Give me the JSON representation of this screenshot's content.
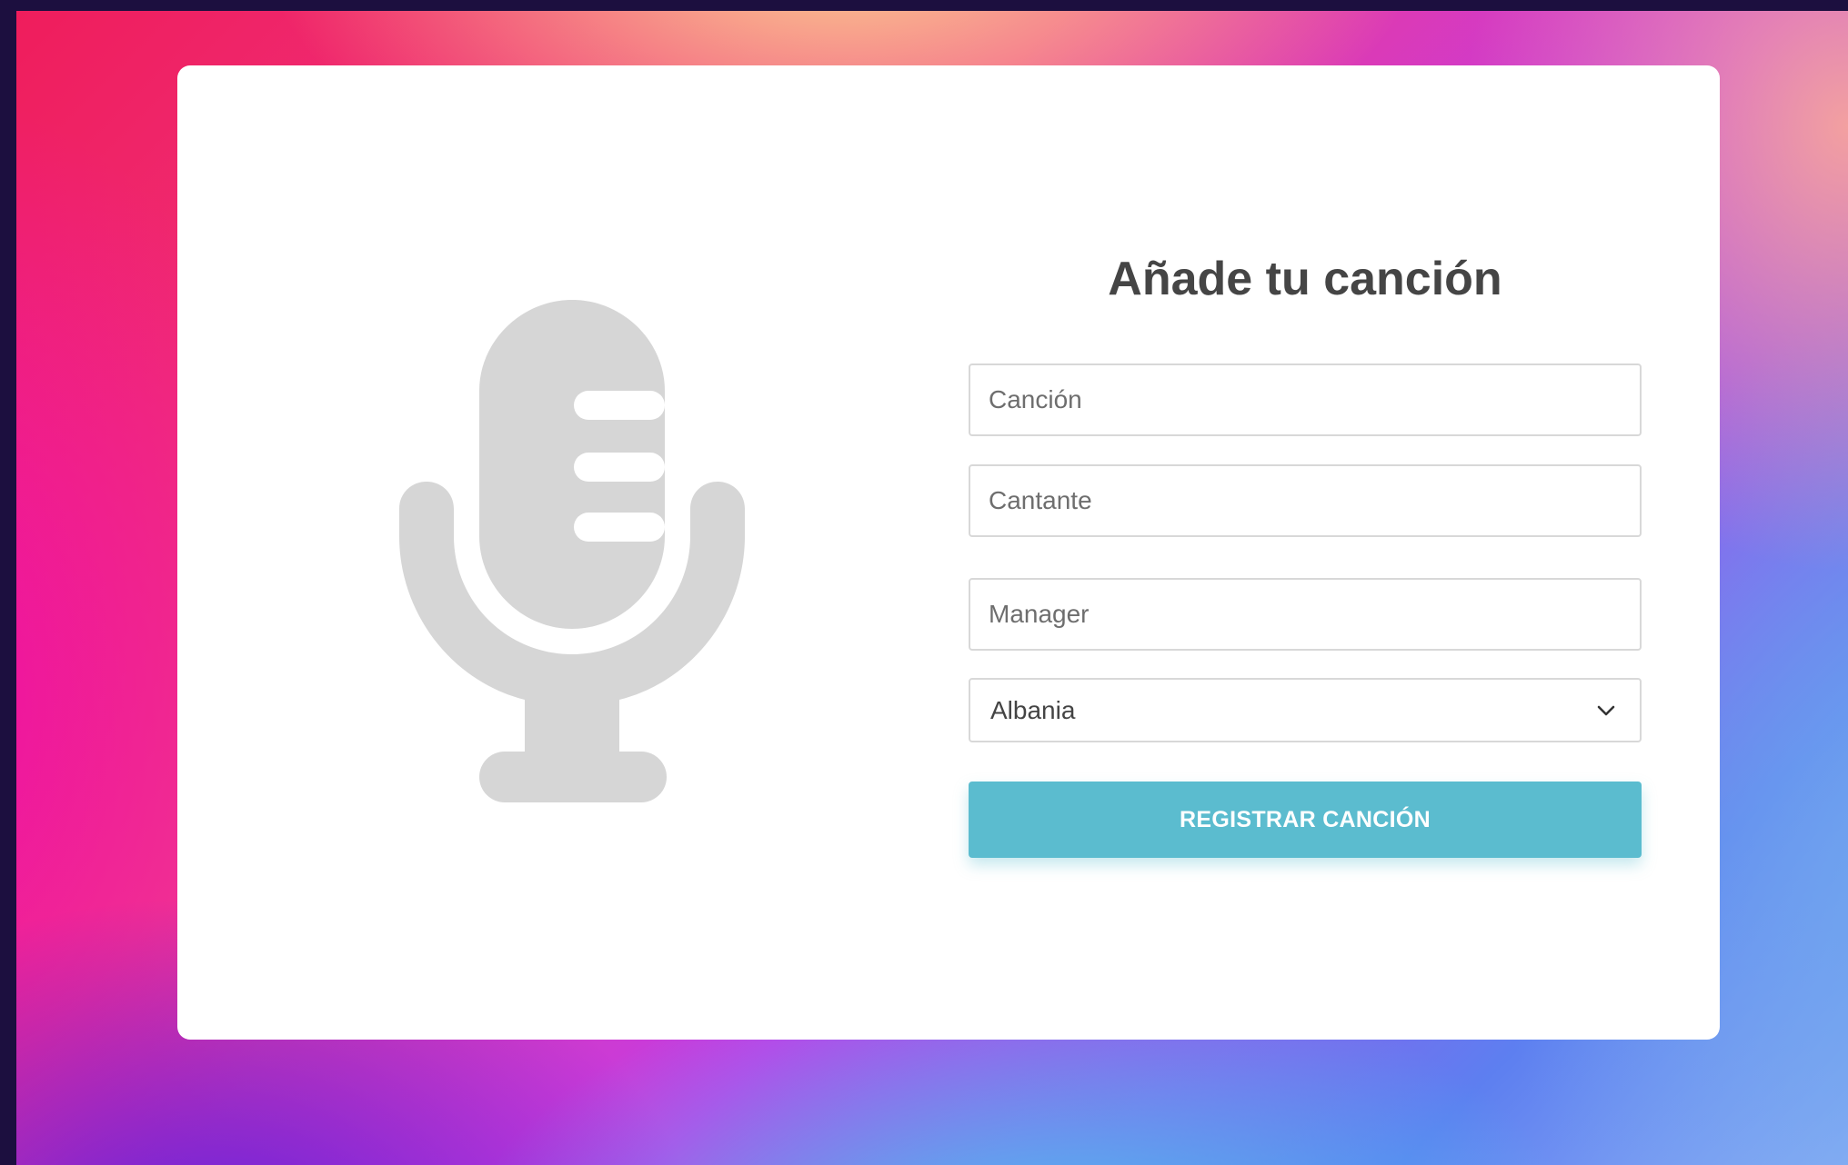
{
  "form": {
    "title": "Añade tu canción",
    "song_placeholder": "Canción",
    "singer_placeholder": "Cantante",
    "manager_placeholder": "Manager",
    "country_selected": "Albania",
    "submit_label": "REGISTRAR CANCIÓN"
  },
  "illustration": {
    "icon": "microphone-icon",
    "color": "#d6d6d6"
  },
  "colors": {
    "accent": "#5bbccf",
    "title": "#454545",
    "border": "#d8d8d8"
  }
}
